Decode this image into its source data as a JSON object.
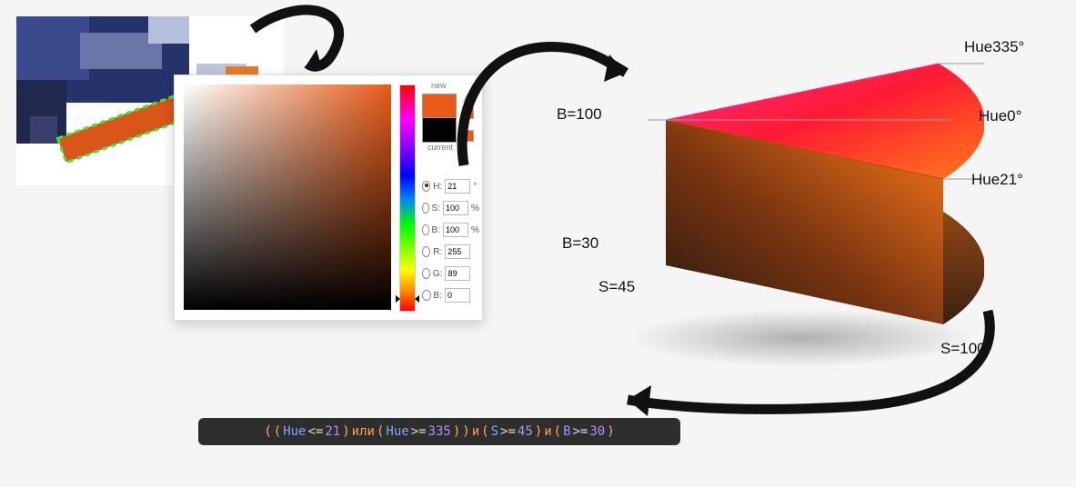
{
  "picker": {
    "label_new": "new",
    "label_current": "current",
    "warning_icon": "⚠",
    "hue_marker_pos_px": 235,
    "fields": [
      {
        "key": "H",
        "value": "21",
        "unit": "°",
        "selected": true
      },
      {
        "key": "S",
        "value": "100",
        "unit": "%",
        "selected": false
      },
      {
        "key": "B",
        "value": "100",
        "unit": "%",
        "selected": false
      },
      {
        "key": "R",
        "value": "255",
        "unit": "",
        "selected": false
      },
      {
        "key": "G",
        "value": "89",
        "unit": "",
        "selected": false
      },
      {
        "key": "B",
        "value": "0",
        "unit": "",
        "selected": false
      }
    ],
    "color_new": "#e85a16",
    "color_current": "#000000"
  },
  "wedge": {
    "labels": {
      "b_top": "B=100",
      "b_bottom": "B=30",
      "s_left": "S=45",
      "s_right": "S=100",
      "hue_top": "Hue335°",
      "hue_mid": "Hue0°",
      "hue_bottom": "Hue21°"
    }
  },
  "formula": {
    "tokens": [
      {
        "t": "(",
        "c": "c-par"
      },
      {
        "t": "(",
        "c": "c-par"
      },
      {
        "t": "Hue",
        "c": "c-var"
      },
      {
        "t": "<=",
        "c": "c-op"
      },
      {
        "t": "21",
        "c": "c-num"
      },
      {
        "t": ")",
        "c": "c-par"
      },
      {
        "t": " или ",
        "c": "c-kw"
      },
      {
        "t": "(",
        "c": "c-par"
      },
      {
        "t": "Hue",
        "c": "c-var"
      },
      {
        "t": ">=",
        "c": "c-op"
      },
      {
        "t": "335",
        "c": "c-num"
      },
      {
        "t": ")",
        "c": "c-par"
      },
      {
        "t": ")",
        "c": "c-par"
      },
      {
        "t": " и ",
        "c": "c-kw"
      },
      {
        "t": "(",
        "c": "c-par"
      },
      {
        "t": "S",
        "c": "c-var"
      },
      {
        "t": ">=",
        "c": "c-op"
      },
      {
        "t": "45",
        "c": "c-num"
      },
      {
        "t": ")",
        "c": "c-par"
      },
      {
        "t": " и ",
        "c": "c-kw"
      },
      {
        "t": "(",
        "c": "c-par"
      },
      {
        "t": "B",
        "c": "c-var"
      },
      {
        "t": ">=",
        "c": "c-op"
      },
      {
        "t": "30",
        "c": "c-num"
      },
      {
        "t": ")",
        "c": "c-par"
      }
    ]
  }
}
